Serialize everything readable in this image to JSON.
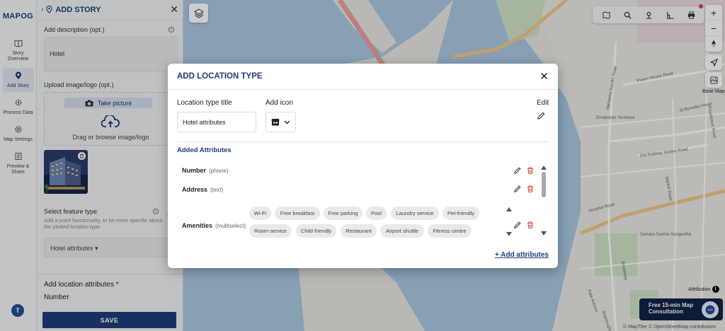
{
  "app": {
    "logo": "MAPOG"
  },
  "rail": {
    "items": [
      {
        "label": "Story Overview",
        "icon": "book-open-icon",
        "active": false
      },
      {
        "label": "Add Story",
        "icon": "location-pin-icon",
        "active": true
      },
      {
        "label": "Process Data",
        "icon": "gear-icon",
        "active": false
      },
      {
        "label": "Map Settings",
        "icon": "settings-icon",
        "active": false
      },
      {
        "label": "Preview & Share",
        "icon": "share-icon",
        "active": false
      }
    ],
    "avatar": "T"
  },
  "panel": {
    "title": "ADD STORY",
    "description_label": "Add description (opt.)",
    "description_value": "Hotel",
    "upload_label": "Upload image/logo (opt.)",
    "take_picture": "Take picture",
    "drag_text": "Drag or browse image/logo",
    "feature_type_label": "Select feature type",
    "feature_hint": "Add a point functionality, to be more specific about the plotted location type",
    "feature_value": "Hotel attributes ▾",
    "location_attrs_label": "Add location attributes *",
    "number_label": "Number",
    "save": "SAVE"
  },
  "map": {
    "base_map_label": "Base Map",
    "attribution": "Attribution",
    "consult_line1": "Free 15-min Map",
    "consult_line2": "Consultation",
    "osm": "© MapTiler © OpenStreetMap contributors",
    "labels": [
      "Power House Road",
      "St Benedict Road",
      "Ernakulam Terminus",
      "Old Railway Station Road",
      "Providence Road",
      "Mahatma Gandhi Road",
      "Hospital Road",
      "Sarkara Sastha Sangeetha",
      "Broadway",
      "Market Road",
      "Park Avenue",
      "Shanmugham Road"
    ]
  },
  "modal": {
    "title": "ADD LOCATION TYPE",
    "type_title_label": "Location type title",
    "type_title_value": "Hotel attributes",
    "add_icon_label": "Add icon",
    "edit_label": "Edit",
    "added_attributes": "Added Attributes",
    "attributes": [
      {
        "name": "Number",
        "type": "(phone)"
      },
      {
        "name": "Address",
        "type": "(text)"
      },
      {
        "name": "Amenities",
        "type": "(multiselect)"
      }
    ],
    "amenities": [
      "Wi-Fi",
      "Free breakfast",
      "Free parking",
      "Pool",
      "Laundry service",
      "Pet-friendly",
      "Room service",
      "Child friendly",
      "Restaurant",
      "Airport shuttle",
      "Fitness centre"
    ],
    "add_attributes": "+ Add attributes"
  }
}
